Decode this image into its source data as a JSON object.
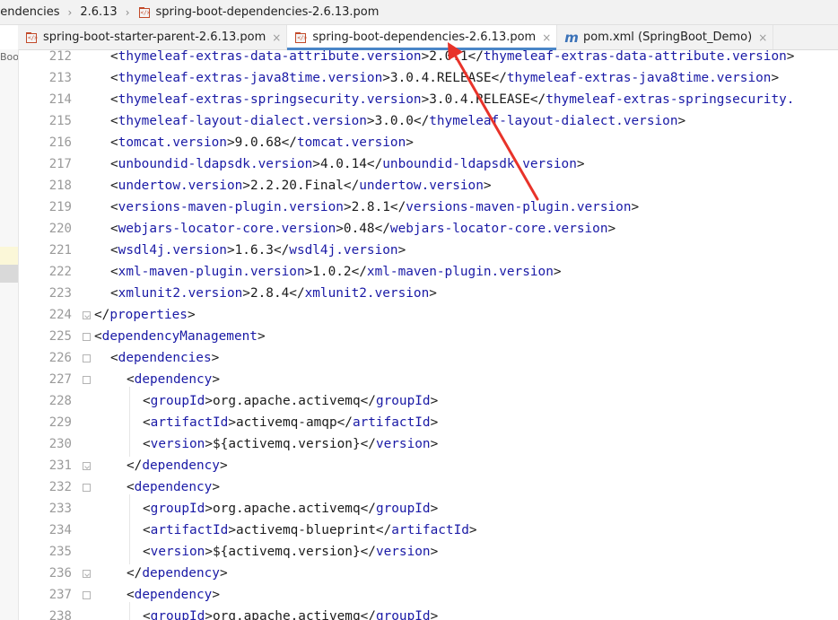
{
  "breadcrumb": {
    "items": [
      "pendencies",
      "2.6.13",
      "spring-boot-dependencies-2.6.13.pom"
    ]
  },
  "tabs": [
    {
      "label": "spring-boot-starter-parent-2.6.13.pom",
      "close": "×",
      "icon": "maven-pom-icon",
      "active": false
    },
    {
      "label": "spring-boot-dependencies-2.6.13.pom",
      "close": "×",
      "icon": "maven-pom-icon",
      "active": true
    },
    {
      "label": "pom.xml (SpringBoot_Demo)",
      "close": "×",
      "icon": "maven-m-icon",
      "active": false
    }
  ],
  "left_panel": {
    "text": "Boo"
  },
  "editor": {
    "lines": [
      {
        "num": "212",
        "indent": 2,
        "parts": [
          [
            "p",
            "<"
          ],
          [
            "t",
            "thymeleaf-extras-data-attribute.version"
          ],
          [
            "p",
            ">2.0.1</"
          ],
          [
            "t",
            "thymeleaf-extras-data-attribute.version"
          ],
          [
            "p",
            ">"
          ]
        ]
      },
      {
        "num": "213",
        "indent": 2,
        "parts": [
          [
            "p",
            "<"
          ],
          [
            "t",
            "thymeleaf-extras-java8time.version"
          ],
          [
            "p",
            ">3.0.4.RELEASE</"
          ],
          [
            "t",
            "thymeleaf-extras-java8time.version"
          ],
          [
            "p",
            ">"
          ]
        ]
      },
      {
        "num": "214",
        "indent": 2,
        "parts": [
          [
            "p",
            "<"
          ],
          [
            "t",
            "thymeleaf-extras-springsecurity.version"
          ],
          [
            "p",
            ">3.0.4.RELEASE</"
          ],
          [
            "t",
            "thymeleaf-extras-springsecurity."
          ]
        ]
      },
      {
        "num": "215",
        "indent": 2,
        "parts": [
          [
            "p",
            "<"
          ],
          [
            "t",
            "thymeleaf-layout-dialect.version"
          ],
          [
            "p",
            ">3.0.0</"
          ],
          [
            "t",
            "thymeleaf-layout-dialect.version"
          ],
          [
            "p",
            ">"
          ]
        ]
      },
      {
        "num": "216",
        "indent": 2,
        "parts": [
          [
            "p",
            "<"
          ],
          [
            "t",
            "tomcat.version"
          ],
          [
            "p",
            ">9.0.68</"
          ],
          [
            "t",
            "tomcat.version"
          ],
          [
            "p",
            ">"
          ]
        ]
      },
      {
        "num": "217",
        "indent": 2,
        "parts": [
          [
            "p",
            "<"
          ],
          [
            "t",
            "unboundid-ldapsdk.version"
          ],
          [
            "p",
            ">4.0.14</"
          ],
          [
            "t",
            "unboundid-ldapsdk.version"
          ],
          [
            "p",
            ">"
          ]
        ]
      },
      {
        "num": "218",
        "indent": 2,
        "parts": [
          [
            "p",
            "<"
          ],
          [
            "t",
            "undertow.version"
          ],
          [
            "p",
            ">2.2.20.Final</"
          ],
          [
            "t",
            "undertow.version"
          ],
          [
            "p",
            ">"
          ]
        ]
      },
      {
        "num": "219",
        "indent": 2,
        "parts": [
          [
            "p",
            "<"
          ],
          [
            "t",
            "versions-maven-plugin.version"
          ],
          [
            "p",
            ">2.8.1</"
          ],
          [
            "t",
            "versions-maven-plugin.version"
          ],
          [
            "p",
            ">"
          ]
        ]
      },
      {
        "num": "220",
        "indent": 2,
        "parts": [
          [
            "p",
            "<"
          ],
          [
            "t",
            "webjars-locator-core.version"
          ],
          [
            "p",
            ">0.48</"
          ],
          [
            "t",
            "webjars-locator-core.version"
          ],
          [
            "p",
            ">"
          ]
        ]
      },
      {
        "num": "221",
        "indent": 2,
        "parts": [
          [
            "p",
            "<"
          ],
          [
            "t",
            "wsdl4j.version"
          ],
          [
            "p",
            ">1.6.3</"
          ],
          [
            "t",
            "wsdl4j.version"
          ],
          [
            "p",
            ">"
          ]
        ]
      },
      {
        "num": "222",
        "indent": 2,
        "parts": [
          [
            "p",
            "<"
          ],
          [
            "t",
            "xml-maven-plugin.version"
          ],
          [
            "p",
            ">1.0.2</"
          ],
          [
            "t",
            "xml-maven-plugin.version"
          ],
          [
            "p",
            ">"
          ]
        ]
      },
      {
        "num": "223",
        "indent": 2,
        "parts": [
          [
            "p",
            "<"
          ],
          [
            "t",
            "xmlunit2.version"
          ],
          [
            "p",
            ">2.8.4</"
          ],
          [
            "t",
            "xmlunit2.version"
          ],
          [
            "p",
            ">"
          ]
        ]
      },
      {
        "num": "224",
        "indent": 1,
        "fold": "close",
        "parts": [
          [
            "p",
            "</"
          ],
          [
            "t",
            "properties"
          ],
          [
            "p",
            ">"
          ]
        ]
      },
      {
        "num": "225",
        "indent": 1,
        "fold": "open",
        "parts": [
          [
            "p",
            "<"
          ],
          [
            "t",
            "dependencyManagement"
          ],
          [
            "p",
            ">"
          ]
        ]
      },
      {
        "num": "226",
        "indent": 2,
        "fold": "open",
        "parts": [
          [
            "p",
            "<"
          ],
          [
            "t",
            "dependencies"
          ],
          [
            "p",
            ">"
          ]
        ]
      },
      {
        "num": "227",
        "indent": 3,
        "fold": "open",
        "parts": [
          [
            "p",
            "<"
          ],
          [
            "t",
            "dependency"
          ],
          [
            "p",
            ">"
          ]
        ]
      },
      {
        "num": "228",
        "indent": 4,
        "parts": [
          [
            "p",
            "<"
          ],
          [
            "t",
            "groupId"
          ],
          [
            "p",
            ">org.apache.activemq</"
          ],
          [
            "t",
            "groupId"
          ],
          [
            "p",
            ">"
          ]
        ]
      },
      {
        "num": "229",
        "indent": 4,
        "parts": [
          [
            "p",
            "<"
          ],
          [
            "t",
            "artifactId"
          ],
          [
            "p",
            ">activemq-amqp</"
          ],
          [
            "t",
            "artifactId"
          ],
          [
            "p",
            ">"
          ]
        ]
      },
      {
        "num": "230",
        "indent": 4,
        "parts": [
          [
            "p",
            "<"
          ],
          [
            "t",
            "version"
          ],
          [
            "p",
            ">${activemq.version}</"
          ],
          [
            "t",
            "version"
          ],
          [
            "p",
            ">"
          ]
        ]
      },
      {
        "num": "231",
        "indent": 3,
        "fold": "close",
        "parts": [
          [
            "p",
            "</"
          ],
          [
            "t",
            "dependency"
          ],
          [
            "p",
            ">"
          ]
        ]
      },
      {
        "num": "232",
        "indent": 3,
        "fold": "open",
        "parts": [
          [
            "p",
            "<"
          ],
          [
            "t",
            "dependency"
          ],
          [
            "p",
            ">"
          ]
        ]
      },
      {
        "num": "233",
        "indent": 4,
        "parts": [
          [
            "p",
            "<"
          ],
          [
            "t",
            "groupId"
          ],
          [
            "p",
            ">org.apache.activemq</"
          ],
          [
            "t",
            "groupId"
          ],
          [
            "p",
            ">"
          ]
        ]
      },
      {
        "num": "234",
        "indent": 4,
        "parts": [
          [
            "p",
            "<"
          ],
          [
            "t",
            "artifactId"
          ],
          [
            "p",
            ">activemq-blueprint</"
          ],
          [
            "t",
            "artifactId"
          ],
          [
            "p",
            ">"
          ]
        ]
      },
      {
        "num": "235",
        "indent": 4,
        "parts": [
          [
            "p",
            "<"
          ],
          [
            "t",
            "version"
          ],
          [
            "p",
            ">${activemq.version}</"
          ],
          [
            "t",
            "version"
          ],
          [
            "p",
            ">"
          ]
        ]
      },
      {
        "num": "236",
        "indent": 3,
        "fold": "close",
        "parts": [
          [
            "p",
            "</"
          ],
          [
            "t",
            "dependency"
          ],
          [
            "p",
            ">"
          ]
        ]
      },
      {
        "num": "237",
        "indent": 3,
        "fold": "open",
        "parts": [
          [
            "p",
            "<"
          ],
          [
            "t",
            "dependency"
          ],
          [
            "p",
            ">"
          ]
        ]
      },
      {
        "num": "238",
        "indent": 4,
        "parts": [
          [
            "p",
            "<"
          ],
          [
            "t",
            "groupId"
          ],
          [
            "p",
            ">org.apache.activemq</"
          ],
          [
            "t",
            "groupId"
          ],
          [
            "p",
            ">"
          ]
        ]
      }
    ]
  },
  "colors": {
    "tag": "#1a1aa6",
    "text": "#1b1b1b",
    "line_number": "#9a9a9a",
    "annotation_arrow": "#e8332a",
    "active_tab_underline": "#4a86c8"
  }
}
